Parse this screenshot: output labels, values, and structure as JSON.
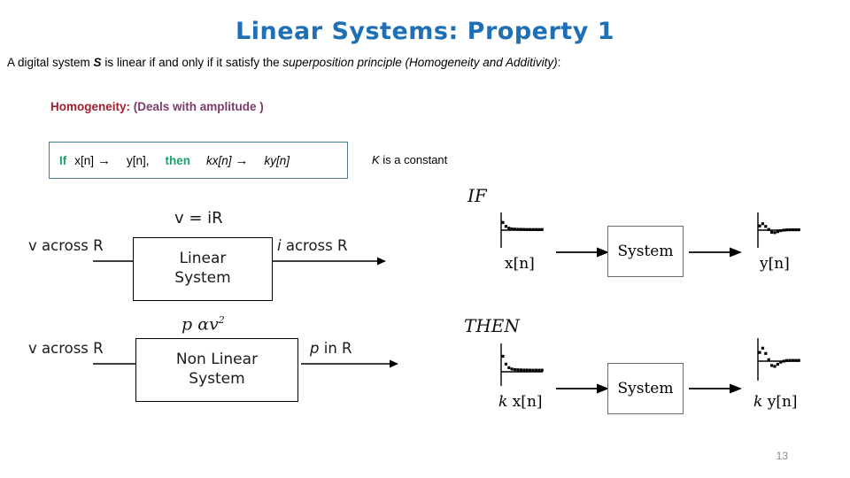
{
  "slide": {
    "title": "Linear Systems: Property 1",
    "title_color": "#1F6FB5",
    "page_number": "13",
    "subtitle": {
      "part1": "A digital system ",
      "system_symbol": "S",
      "part2": " is linear if and only if it satisfy the ",
      "italic_part": "superposition principle (Homogeneity and Additivity)",
      "part3": ":"
    }
  },
  "homogeneity": {
    "label": "Homogeneity:",
    "label_color": "#A02030",
    "note": "(Deals with amplitude )",
    "note_color": "#7B3A6E",
    "equation": {
      "if_keyword": "If",
      "input": "x[n]",
      "arrow": "→",
      "output": "y[n],",
      "then_keyword": "then",
      "scaled_input": "kx[n]",
      "arrow2": "→",
      "scaled_output": "ky[n]",
      "border_color": "#4A7A8C",
      "keyword_color": "#1FA06A"
    },
    "constant_note_k": "K",
    "constant_note_rest": " is a constant"
  },
  "left_diagrams": [
    {
      "relation": "v = iR",
      "input_label": "v across R",
      "box_line1": "Linear",
      "box_line2": "System",
      "output_label_italic": "i",
      "output_label_rest": " across R"
    },
    {
      "relation_p": "p",
      "relation_alpha": "α",
      "relation_v": "v",
      "relation_exp": "2",
      "input_label": "v across R",
      "box_line1": "Non Linear",
      "box_line2": "System",
      "output_label_italic": "p",
      "output_label_rest": " in R"
    }
  ],
  "right_diagrams": [
    {
      "condition": "IF",
      "input_signal_label": "x[n]",
      "input_signal_prefix": "",
      "system_label": "System",
      "output_signal_prefix": "",
      "output_signal_label": "y[n]",
      "input_samples": [
        0.62,
        0.3,
        0.16,
        0.1,
        0.08,
        0.07,
        0.06,
        0.06,
        0.05,
        0.05,
        0.05,
        0.05,
        0.05,
        0.05
      ],
      "output_samples": [
        0.34,
        0.52,
        0.3,
        0.05,
        -0.17,
        -0.2,
        -0.12,
        -0.04,
        0.0,
        0.02,
        0.03,
        0.03,
        0.03,
        0.03
      ]
    },
    {
      "condition": "THEN",
      "input_signal_prefix": "k",
      "input_signal_label": "x[n]",
      "system_label": "System",
      "output_signal_prefix": "k",
      "output_signal_label": "y[n]",
      "input_samples": [
        1.25,
        0.62,
        0.33,
        0.22,
        0.18,
        0.16,
        0.15,
        0.14,
        0.14,
        0.13,
        0.13,
        0.13,
        0.13,
        0.13
      ],
      "output_samples": [
        0.7,
        1.05,
        0.62,
        0.12,
        -0.35,
        -0.42,
        -0.25,
        -0.08,
        0.0,
        0.05,
        0.06,
        0.06,
        0.06,
        0.06
      ]
    }
  ]
}
